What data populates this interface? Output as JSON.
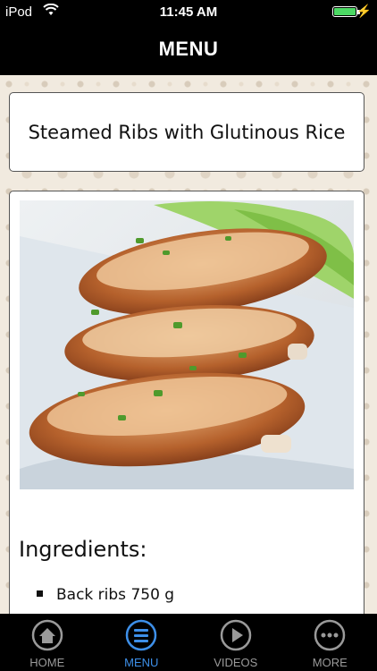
{
  "status_bar": {
    "carrier": "iPod",
    "time": "11:45 AM",
    "battery_level": 1.0
  },
  "nav": {
    "title": "MENU"
  },
  "recipe": {
    "title": "Steamed Ribs with Glutinous Rice",
    "ingredients_heading": "Ingredients:",
    "ingredients": [
      "Back ribs 750 g"
    ]
  },
  "tabs": [
    {
      "label": "HOME",
      "icon": "home-icon",
      "active": false
    },
    {
      "label": "MENU",
      "icon": "menu-icon",
      "active": true
    },
    {
      "label": "VIDEOS",
      "icon": "play-icon",
      "active": false
    },
    {
      "label": "MORE",
      "icon": "more-icon",
      "active": false
    }
  ],
  "colors": {
    "active_tab": "#3d8fe8",
    "inactive_tab": "#9a9a9a",
    "bar_background": "#000000",
    "battery": "#4cd964"
  }
}
